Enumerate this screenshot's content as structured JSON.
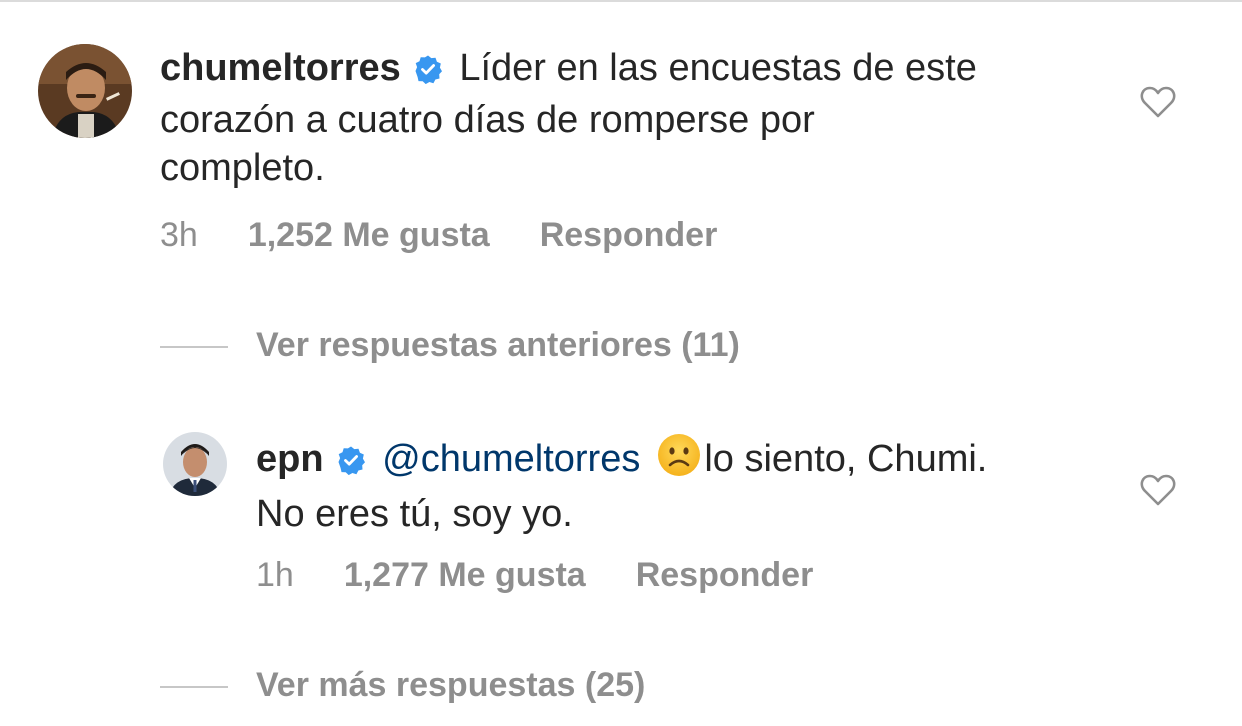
{
  "comments": [
    {
      "username": "chumeltorres",
      "verified": true,
      "text": "Líder en las encuestas de este corazón a cuatro días de romperse por completo.",
      "text_line1": "Líder en las encuestas de este",
      "text_line2": "corazón a cuatro días de romperse por",
      "text_line3": "completo.",
      "time": "3h",
      "likes": "1,252 Me gusta",
      "reply_label": "Responder",
      "like_icon": "heart-outline-icon"
    },
    {
      "username": "epn",
      "verified": true,
      "mention": "@chumeltorres",
      "emoji": "☹",
      "text_line1": "lo siento, Chumi.",
      "text_line2": "No eres tú, soy yo.",
      "time": "1h",
      "likes": "1,277 Me gusta",
      "reply_label": "Responder",
      "like_icon": "heart-outline-icon"
    }
  ],
  "view_previous_replies": "Ver respuestas anteriores (11)",
  "view_more_replies": "Ver más respuestas (25)",
  "colors": {
    "text": "#262626",
    "secondary": "#8e8e8e",
    "verified": "#3897f0",
    "mention": "#00376b"
  }
}
